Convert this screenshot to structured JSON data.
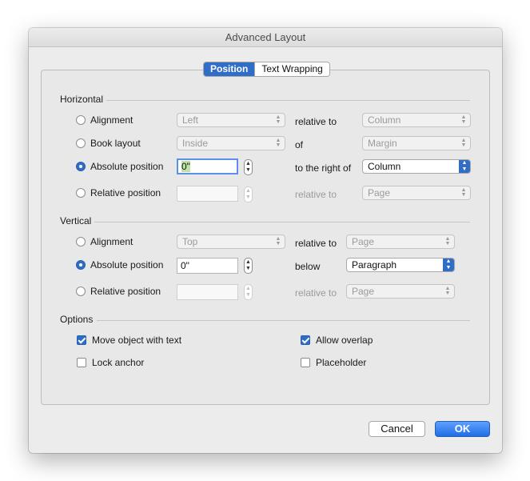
{
  "window": {
    "title": "Advanced Layout"
  },
  "tabs": [
    {
      "label": "Position",
      "active": true
    },
    {
      "label": "Text Wrapping",
      "active": false
    }
  ],
  "horizontal": {
    "label": "Horizontal",
    "alignment": {
      "label": "Alignment",
      "value": "Left",
      "relation": "relative to",
      "relation_value": "Column"
    },
    "book_layout": {
      "label": "Book layout",
      "value": "Inside",
      "relation": "of",
      "relation_value": "Margin"
    },
    "absolute_position": {
      "label": "Absolute position",
      "value": "0\"",
      "relation": "to the right of",
      "relation_value": "Column"
    },
    "relative_position": {
      "label": "Relative position",
      "value": "",
      "relation": "relative to",
      "relation_value": "Page"
    }
  },
  "vertical": {
    "label": "Vertical",
    "alignment": {
      "label": "Alignment",
      "value": "Top",
      "relation": "relative to",
      "relation_value": "Page"
    },
    "absolute_position": {
      "label": "Absolute position",
      "value": "0\"",
      "relation": "below",
      "relation_value": "Paragraph"
    },
    "relative_position": {
      "label": "Relative position",
      "value": "",
      "relation": "relative to",
      "relation_value": "Page"
    }
  },
  "options": {
    "label": "Options",
    "move_object_with_text": {
      "label": "Move object with text",
      "checked": true
    },
    "allow_overlap": {
      "label": "Allow overlap",
      "checked": true
    },
    "lock_anchor": {
      "label": "Lock anchor",
      "checked": false
    },
    "placeholder": {
      "label": "Placeholder",
      "checked": false
    }
  },
  "buttons": {
    "cancel": "Cancel",
    "ok": "OK"
  },
  "colors": {
    "accent": "#2f6dc7",
    "window_bg": "#ececec",
    "panel_bg": "#e8e8e8"
  },
  "icons": {
    "popup_arrows": "up-down-chevron-icon",
    "stepper": "stepper-arrows-icon"
  }
}
